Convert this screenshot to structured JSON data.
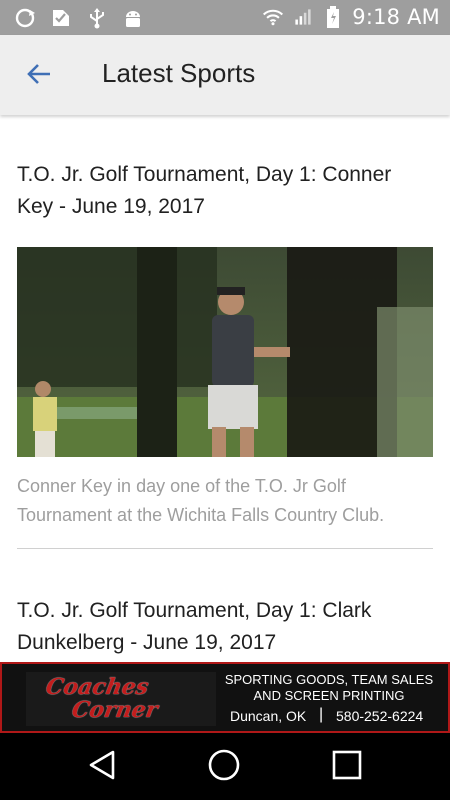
{
  "status_bar": {
    "time": "9:18 AM",
    "left_icons": [
      "sync-icon",
      "edit-check-icon",
      "usb-icon",
      "android-icon"
    ],
    "right_icons": [
      "wifi-icon",
      "signal-icon",
      "battery-icon"
    ]
  },
  "app_bar": {
    "title": "Latest Sports",
    "back_icon": "arrow-back-icon"
  },
  "articles": [
    {
      "title": "T.O. Jr. Golf Tournament, Day 1: Conner Key - June 19, 2017",
      "caption": "Conner Key in day one of the T.O. Jr Golf Tournament at the Wichita Falls Country Club."
    },
    {
      "title": "T.O. Jr. Golf Tournament, Day 1: Clark Dunkelberg - June 19, 2017"
    }
  ],
  "ad": {
    "logo_text_line1": "Coaches",
    "logo_text_line2": "Corner",
    "line1": "SPORTING GOODS, TEAM SALES",
    "line2": "AND SCREEN PRINTING",
    "city": "Duncan, OK",
    "separator": "|",
    "phone": "580-252-6224",
    "accent_color": "#c21d1d"
  },
  "nav_bar": {
    "buttons": [
      "back-triangle-icon",
      "home-circle-icon",
      "recents-square-icon"
    ]
  },
  "colors": {
    "status_bar": "#9e9e9e",
    "app_bar": "#eeeeee",
    "back_arrow": "#3f6fb5",
    "caption": "#9e9e9e"
  }
}
